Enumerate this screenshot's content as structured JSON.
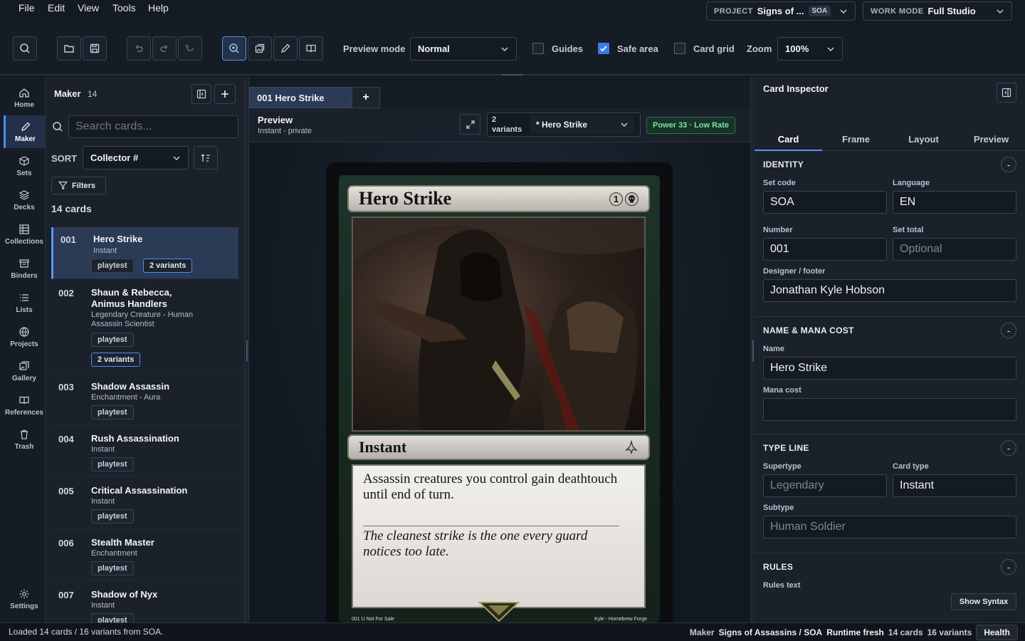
{
  "menu": [
    "File",
    "Edit",
    "View",
    "Tools",
    "Help"
  ],
  "project": {
    "label": "PROJECT",
    "name": "Signs of ...",
    "code": "SOA"
  },
  "work_mode": {
    "label": "WORK MODE",
    "value": "Full Studio"
  },
  "toolbar": {
    "preview_mode_label": "Preview mode",
    "preview_mode_value": "Normal",
    "guides_label": "Guides",
    "guides_checked": false,
    "safe_area_label": "Safe area",
    "safe_area_checked": true,
    "card_grid_label": "Card grid",
    "card_grid_checked": false,
    "zoom_label": "Zoom",
    "zoom_value": "100%"
  },
  "nav": [
    {
      "label": "Home",
      "icon": "home-icon"
    },
    {
      "label": "Maker",
      "icon": "pencil-icon",
      "active": true
    },
    {
      "label": "Sets",
      "icon": "box-icon"
    },
    {
      "label": "Decks",
      "icon": "layers-icon"
    },
    {
      "label": "Collections",
      "icon": "grid-icon"
    },
    {
      "label": "Binders",
      "icon": "archive-icon"
    },
    {
      "label": "Lists",
      "icon": "list-icon"
    },
    {
      "label": "Projects",
      "icon": "globe-icon"
    },
    {
      "label": "Gallery",
      "icon": "gallery-icon"
    },
    {
      "label": "References",
      "icon": "book-icon"
    },
    {
      "label": "Trash",
      "icon": "trash-icon"
    },
    {
      "label": "Settings",
      "icon": "gear-icon"
    }
  ],
  "list": {
    "title": "Maker",
    "count": "14",
    "search_placeholder": "Search cards...",
    "sort_label": "SORT",
    "sort_value": "Collector #",
    "filters_label": "Filters",
    "cards_count": "14 cards",
    "cards": [
      {
        "num": "001",
        "name": "Hero Strike",
        "type": "Instant",
        "tag": "playtest",
        "variants": "2 variants"
      },
      {
        "num": "002",
        "name": "Shaun & Rebecca, Animus Handlers",
        "type": "Legendary Creature - Human Assassin Scientist",
        "tag": "playtest",
        "variants": "2 variants"
      },
      {
        "num": "003",
        "name": "Shadow Assassin",
        "type": "Enchantment - Aura",
        "tag": "playtest"
      },
      {
        "num": "004",
        "name": "Rush Assassination",
        "type": "Instant",
        "tag": "playtest"
      },
      {
        "num": "005",
        "name": "Critical Assassination",
        "type": "Instant",
        "tag": "playtest"
      },
      {
        "num": "006",
        "name": "Stealth Master",
        "type": "Enchantment",
        "tag": "playtest"
      },
      {
        "num": "007",
        "name": "Shadow of Nyx",
        "type": "Instant",
        "tag": "playtest"
      }
    ]
  },
  "doc_tab": {
    "label": "001 Hero Strike",
    "close": "x",
    "add": "+"
  },
  "preview": {
    "title": "Preview",
    "subtitle": "Instant - private",
    "variants_count": "2",
    "variants_word": "variants",
    "variant_value": "* Hero Strike",
    "power": "Power 33 · Low Rate"
  },
  "card": {
    "name": "Hero Strike",
    "cost": "1",
    "type": "Instant",
    "rules": "Assassin creatures you control gain deathtouch until end of turn.",
    "flavor": "The cleanest strike is the one every guard notices too late.",
    "footer_left": "001 U Not For Sale",
    "footer_right": "Kyle - Homebrew Forge"
  },
  "inspector": {
    "title": "Card Inspector",
    "tabs": [
      "Card",
      "Frame",
      "Layout",
      "Preview"
    ],
    "identity": {
      "title": "IDENTITY",
      "set_code_label": "Set code",
      "set_code": "SOA",
      "language_label": "Language",
      "language": "EN",
      "number_label": "Number",
      "number": "001",
      "set_total_label": "Set total",
      "set_total_placeholder": "Optional",
      "designer_label": "Designer / footer",
      "designer": "Jonathan Kyle Hobson"
    },
    "name_cost": {
      "title": "NAME & MANA COST",
      "name_label": "Name",
      "name": "Hero Strike",
      "mana_label": "Mana cost",
      "mana": ""
    },
    "type_line": {
      "title": "TYPE LINE",
      "supertype_label": "Supertype",
      "supertype_placeholder": "Legendary",
      "card_type_label": "Card type",
      "card_type": "Instant",
      "subtype_label": "Subtype",
      "subtype_placeholder": "Human Soldier"
    },
    "rules": {
      "title": "RULES",
      "rules_label": "Rules text",
      "syntax_button": "Show Syntax"
    },
    "collapse": "-"
  },
  "status": {
    "left": "Loaded 14 cards / 16 variants from SOA.",
    "maker": "Maker",
    "project": "Signs of Assassins / SOA",
    "runtime": "Runtime fresh",
    "cards": "14 cards",
    "variants": "16 variants",
    "health": "Health"
  }
}
